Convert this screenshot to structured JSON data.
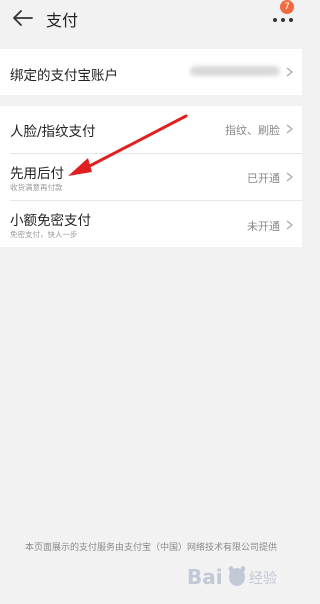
{
  "header": {
    "title": "支付",
    "badge": "7"
  },
  "account": {
    "label": "绑定的支付宝账户"
  },
  "options": [
    {
      "label": "人脸/指纹支付",
      "sub": "",
      "value": "指纹、刷脸"
    },
    {
      "label": "先用后付",
      "sub": "收货满意再付款",
      "value": "已开通"
    },
    {
      "label": "小额免密支付",
      "sub": "免密支付，快人一步",
      "value": "未开通"
    }
  ],
  "footer": {
    "text": "本页面展示的支付服务由支付宝（中国）网络技术有限公司提供"
  },
  "watermark": {
    "text": "Bai 经验"
  },
  "colors": {
    "badge": "#f26a3f",
    "arrow": "#e02020"
  }
}
